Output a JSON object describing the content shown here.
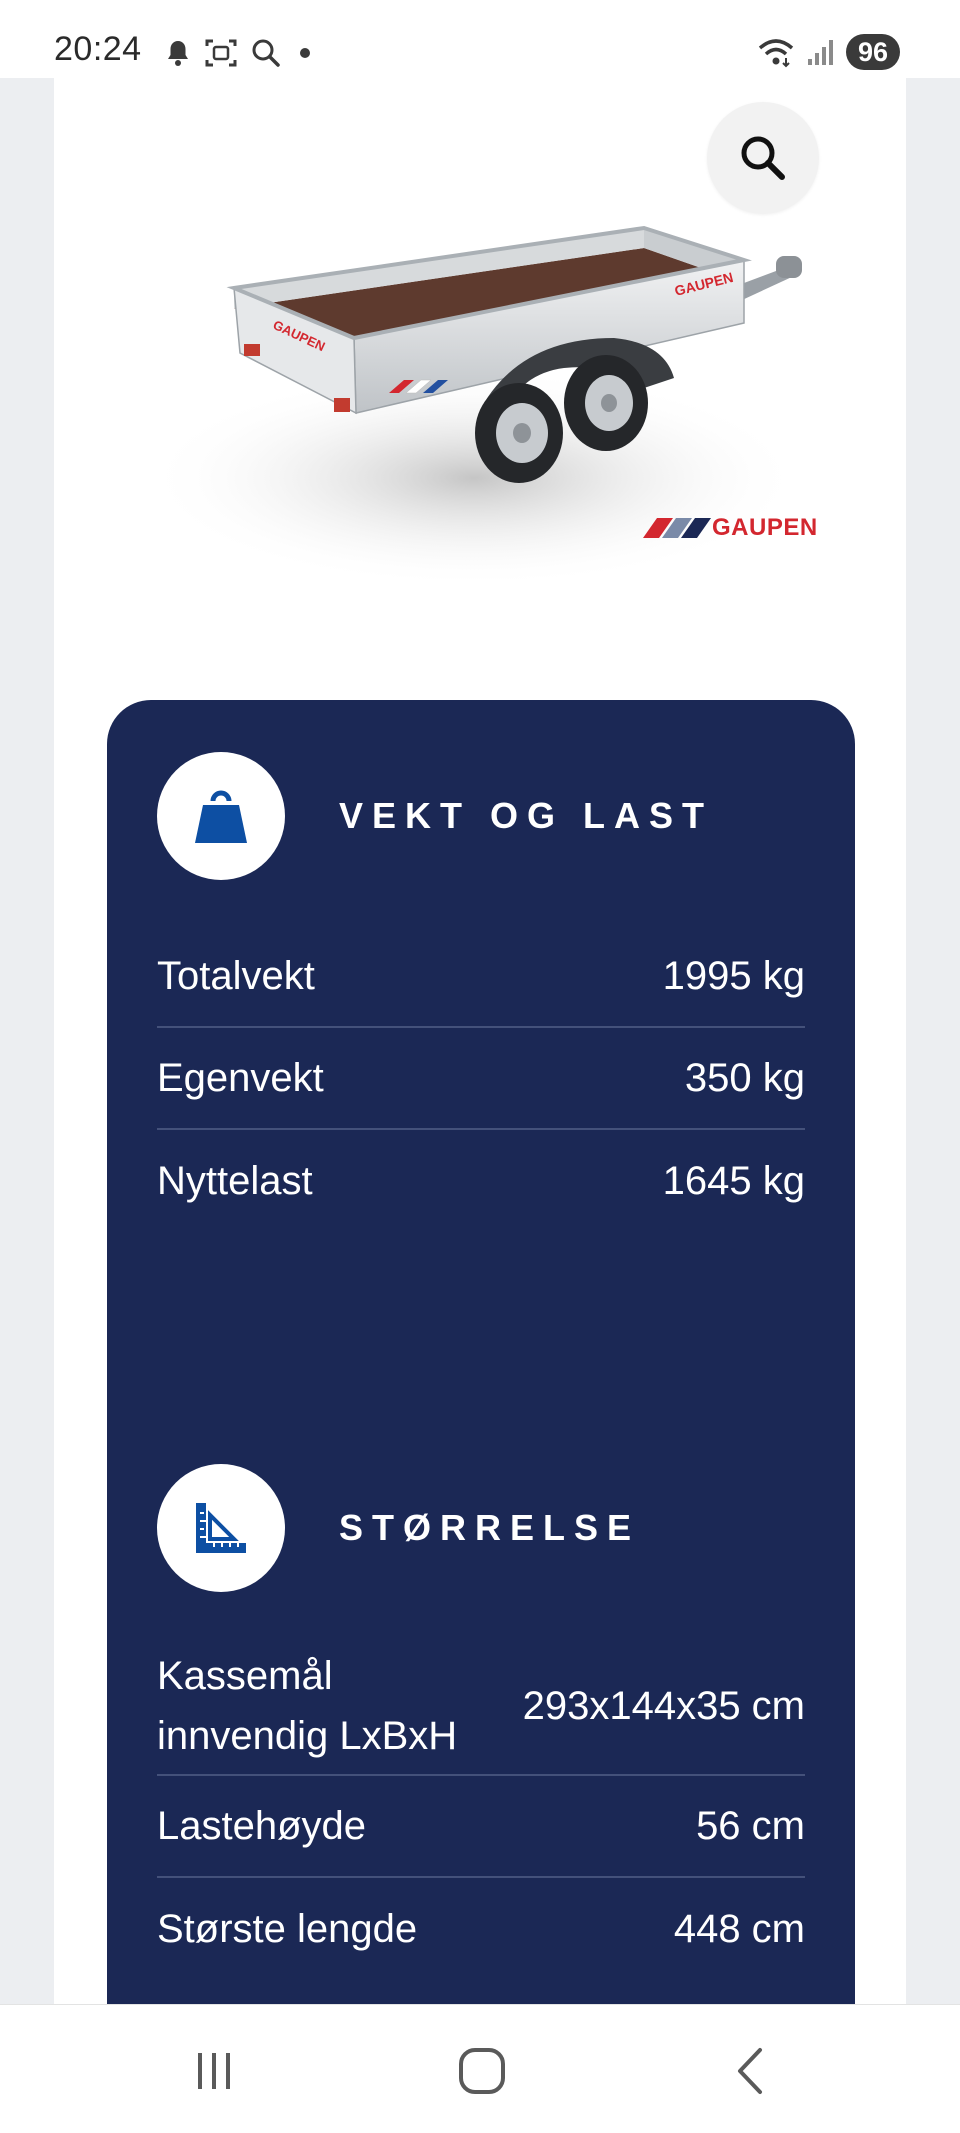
{
  "status_bar": {
    "time": "20:24",
    "left_icons": [
      "bell-icon",
      "screenshot-icon",
      "search-icon",
      "dot-icon"
    ],
    "right_icons": [
      "wifi-icon",
      "signal-icon"
    ],
    "battery": "96"
  },
  "product": {
    "image_alt": "Gaupen trailer",
    "brand": "GAUPEN",
    "brand_colors": [
      "#d3272f",
      "#1b2855",
      "#7a8aa8"
    ],
    "zoom_icon": "magnifier-icon"
  },
  "specs": {
    "weight": {
      "title": "VEKT OG LAST",
      "icon": "weight-icon",
      "rows": [
        {
          "label": "Totalvekt",
          "value": "1995 kg"
        },
        {
          "label": "Egenvekt",
          "value": "350 kg"
        },
        {
          "label": "Nyttelast",
          "value": "1645 kg"
        }
      ]
    },
    "size": {
      "title": "STØRRELSE",
      "icon": "ruler-icon",
      "rows": [
        {
          "label": "Kassemål innvendig LxBxH",
          "value": "293x144x35 cm"
        },
        {
          "label": "Lastehøyde",
          "value": "56 cm"
        },
        {
          "label": "Største lengde",
          "value": "448 cm"
        }
      ]
    }
  },
  "colors": {
    "card_bg": "#1b2855",
    "icon_blue": "#0d4fa3",
    "accent_red": "#d3272f"
  },
  "navigation": {
    "recent_apps_icon": "recent-apps-icon",
    "home_icon": "home-icon",
    "back_icon": "back-icon"
  }
}
